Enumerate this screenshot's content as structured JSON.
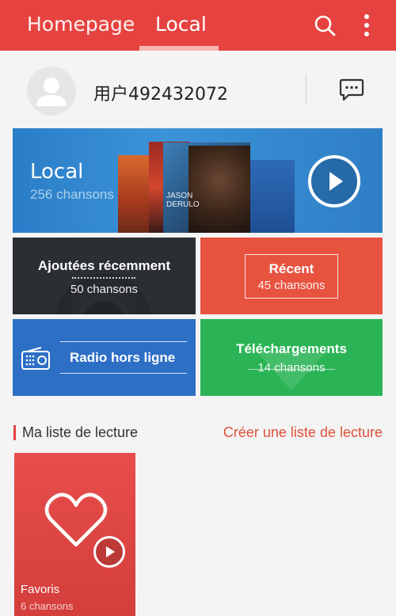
{
  "header": {
    "tabs": [
      {
        "label": "Homepage",
        "active": false
      },
      {
        "label": "Local",
        "active": true
      }
    ],
    "icons": [
      "search-icon",
      "more-vertical-icon"
    ],
    "accent": "#e64340"
  },
  "profile": {
    "username": "用户492432072",
    "icons": [
      "avatar-placeholder-icon",
      "chat-icon"
    ]
  },
  "local_card": {
    "title": "Local",
    "count": "256 chansons",
    "album_text": "JASON DERULO"
  },
  "tiles": {
    "recently_added": {
      "title": "Ajoutées récemment",
      "count": "50 chansons"
    },
    "recent": {
      "title": "Récent",
      "count": "45 chansons"
    },
    "radio": {
      "title": "Radio hors ligne",
      "icon": "radio-icon"
    },
    "downloads": {
      "title": "Téléchargements",
      "count": "14 chansons"
    }
  },
  "playlists": {
    "section_title": "Ma liste de lecture",
    "create_label": "Créer une liste de lecture",
    "items": [
      {
        "name": "Favoris",
        "count": "6 chansons",
        "icon": "heart-icon"
      }
    ]
  }
}
